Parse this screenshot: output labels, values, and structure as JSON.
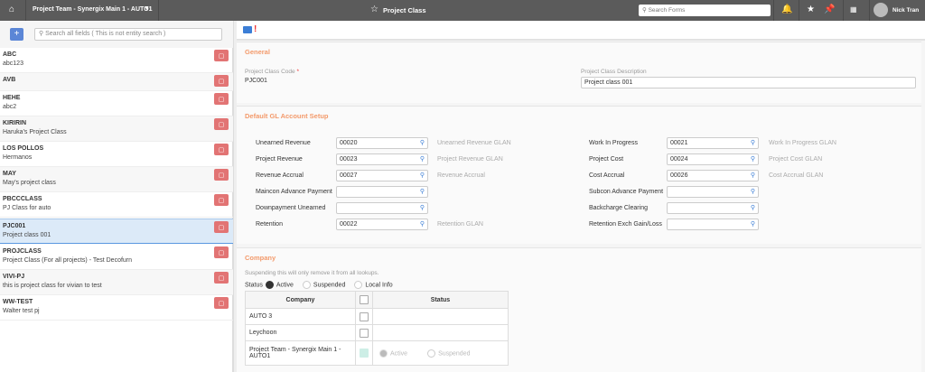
{
  "topbar": {
    "team": "Project Team - Synergix Main 1 - AUTO1",
    "title": "Project Class",
    "search_placeholder": "Search Forms",
    "user": "Nick Tran"
  },
  "left": {
    "search_placeholder": "Search all fields ( This is not entity search )",
    "add_label": "+",
    "items": [
      {
        "code": "ABC",
        "desc": "abc123"
      },
      {
        "code": "AVB",
        "desc": ""
      },
      {
        "code": "HEHE",
        "desc": "abc2"
      },
      {
        "code": "KIRIRIN",
        "desc": "Haruka's Project Class"
      },
      {
        "code": "LOS POLLOS",
        "desc": "Hermanos"
      },
      {
        "code": "MAY",
        "desc": "May's project class"
      },
      {
        "code": "PBCCCLASS",
        "desc": "PJ Class for auto"
      },
      {
        "code": "PJC001",
        "desc": "Project class 001"
      },
      {
        "code": "PROJCLASS",
        "desc": "Project Class (For all projects) - Test Decofurn"
      },
      {
        "code": "VIVI-PJ",
        "desc": "this is project class for vivian to test"
      },
      {
        "code": "WW-TEST",
        "desc": "Walter test pj"
      }
    ]
  },
  "general": {
    "title": "General",
    "code_label": "Project Class Code",
    "required": "*",
    "code_value": "PJC001",
    "desc_label": "Project Class Description",
    "desc_value": "Project class 001"
  },
  "gl": {
    "title": "Default GL Account Setup",
    "left": [
      {
        "label": "Unearned Revenue",
        "value": "00020",
        "glan": "Unearned Revenue GLAN"
      },
      {
        "label": "Project Revenue",
        "value": "00023",
        "glan": "Project Revenue GLAN"
      },
      {
        "label": "Revenue Accrual",
        "value": "00027",
        "glan": "Revenue Accrual"
      },
      {
        "label": "Maincon Advance Payment",
        "value": "",
        "glan": ""
      },
      {
        "label": "Downpayment Unearned",
        "value": "",
        "glan": ""
      },
      {
        "label": "Retention",
        "value": "00022",
        "glan": "Retention GLAN"
      }
    ],
    "right": [
      {
        "label": "Work In Progress",
        "value": "00021",
        "glan": "Work In Progress GLAN"
      },
      {
        "label": "Project Cost",
        "value": "00024",
        "glan": "Project Cost GLAN"
      },
      {
        "label": "Cost Accrual",
        "value": "00026",
        "glan": "Cost Accrual GLAN"
      },
      {
        "label": "Subcon Advance Payment",
        "value": "",
        "glan": ""
      },
      {
        "label": "Backcharge Clearing",
        "value": "",
        "glan": ""
      },
      {
        "label": "Retention Exch Gain/Loss",
        "value": "",
        "glan": ""
      }
    ]
  },
  "company": {
    "title": "Company",
    "note": "Suspending this will only remove it from all lookups.",
    "status_label": "Status",
    "options": [
      "Active",
      "Suspended",
      "Local Info"
    ],
    "headers": [
      "Company",
      "Status"
    ],
    "rows": [
      {
        "name": "AUTO 3"
      },
      {
        "name": "Leychoon"
      },
      {
        "name": "Project Team - Synergix Main 1 - AUTO1",
        "active": "Active",
        "suspended": "Suspended"
      }
    ]
  }
}
